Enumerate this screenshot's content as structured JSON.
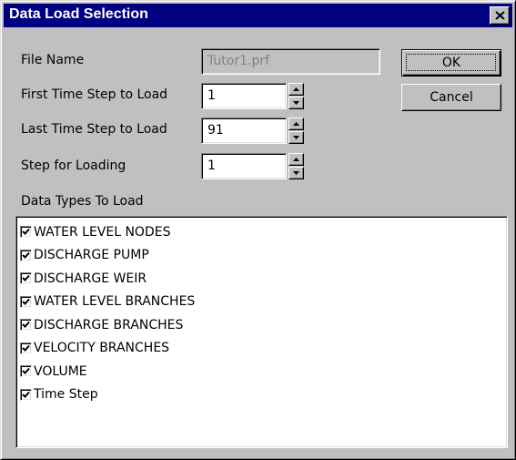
{
  "window": {
    "title": "Data Load Selection",
    "close_label": "Close"
  },
  "file_name": {
    "label": "File Name",
    "value": "Tutor1.prf"
  },
  "first_step": {
    "label": "First Time Step to Load",
    "value": "1"
  },
  "last_step": {
    "label": "Last Time Step to Load",
    "value": "91"
  },
  "step_loading": {
    "label": "Step for Loading",
    "value": "1"
  },
  "buttons": {
    "ok_label": "OK",
    "cancel_label": "Cancel"
  },
  "data_types": {
    "label": "Data Types To Load",
    "items": [
      {
        "label": "WATER LEVEL NODES",
        "checked": true
      },
      {
        "label": "DISCHARGE PUMP",
        "checked": true
      },
      {
        "label": "DISCHARGE WEIR",
        "checked": true
      },
      {
        "label": "WATER LEVEL BRANCHES",
        "checked": true
      },
      {
        "label": "DISCHARGE BRANCHES",
        "checked": true
      },
      {
        "label": "VELOCITY BRANCHES",
        "checked": true
      },
      {
        "label": "VOLUME",
        "checked": true
      },
      {
        "label": "Time Step",
        "checked": true
      }
    ]
  },
  "icons": {
    "close": "close-icon",
    "spin_up": "arrow-up-icon",
    "spin_down": "arrow-down-icon",
    "check": "checkmark-icon"
  },
  "colors": {
    "titlebar": "#000080",
    "face": "#c0c0c0",
    "disabled_text": "#808080"
  }
}
